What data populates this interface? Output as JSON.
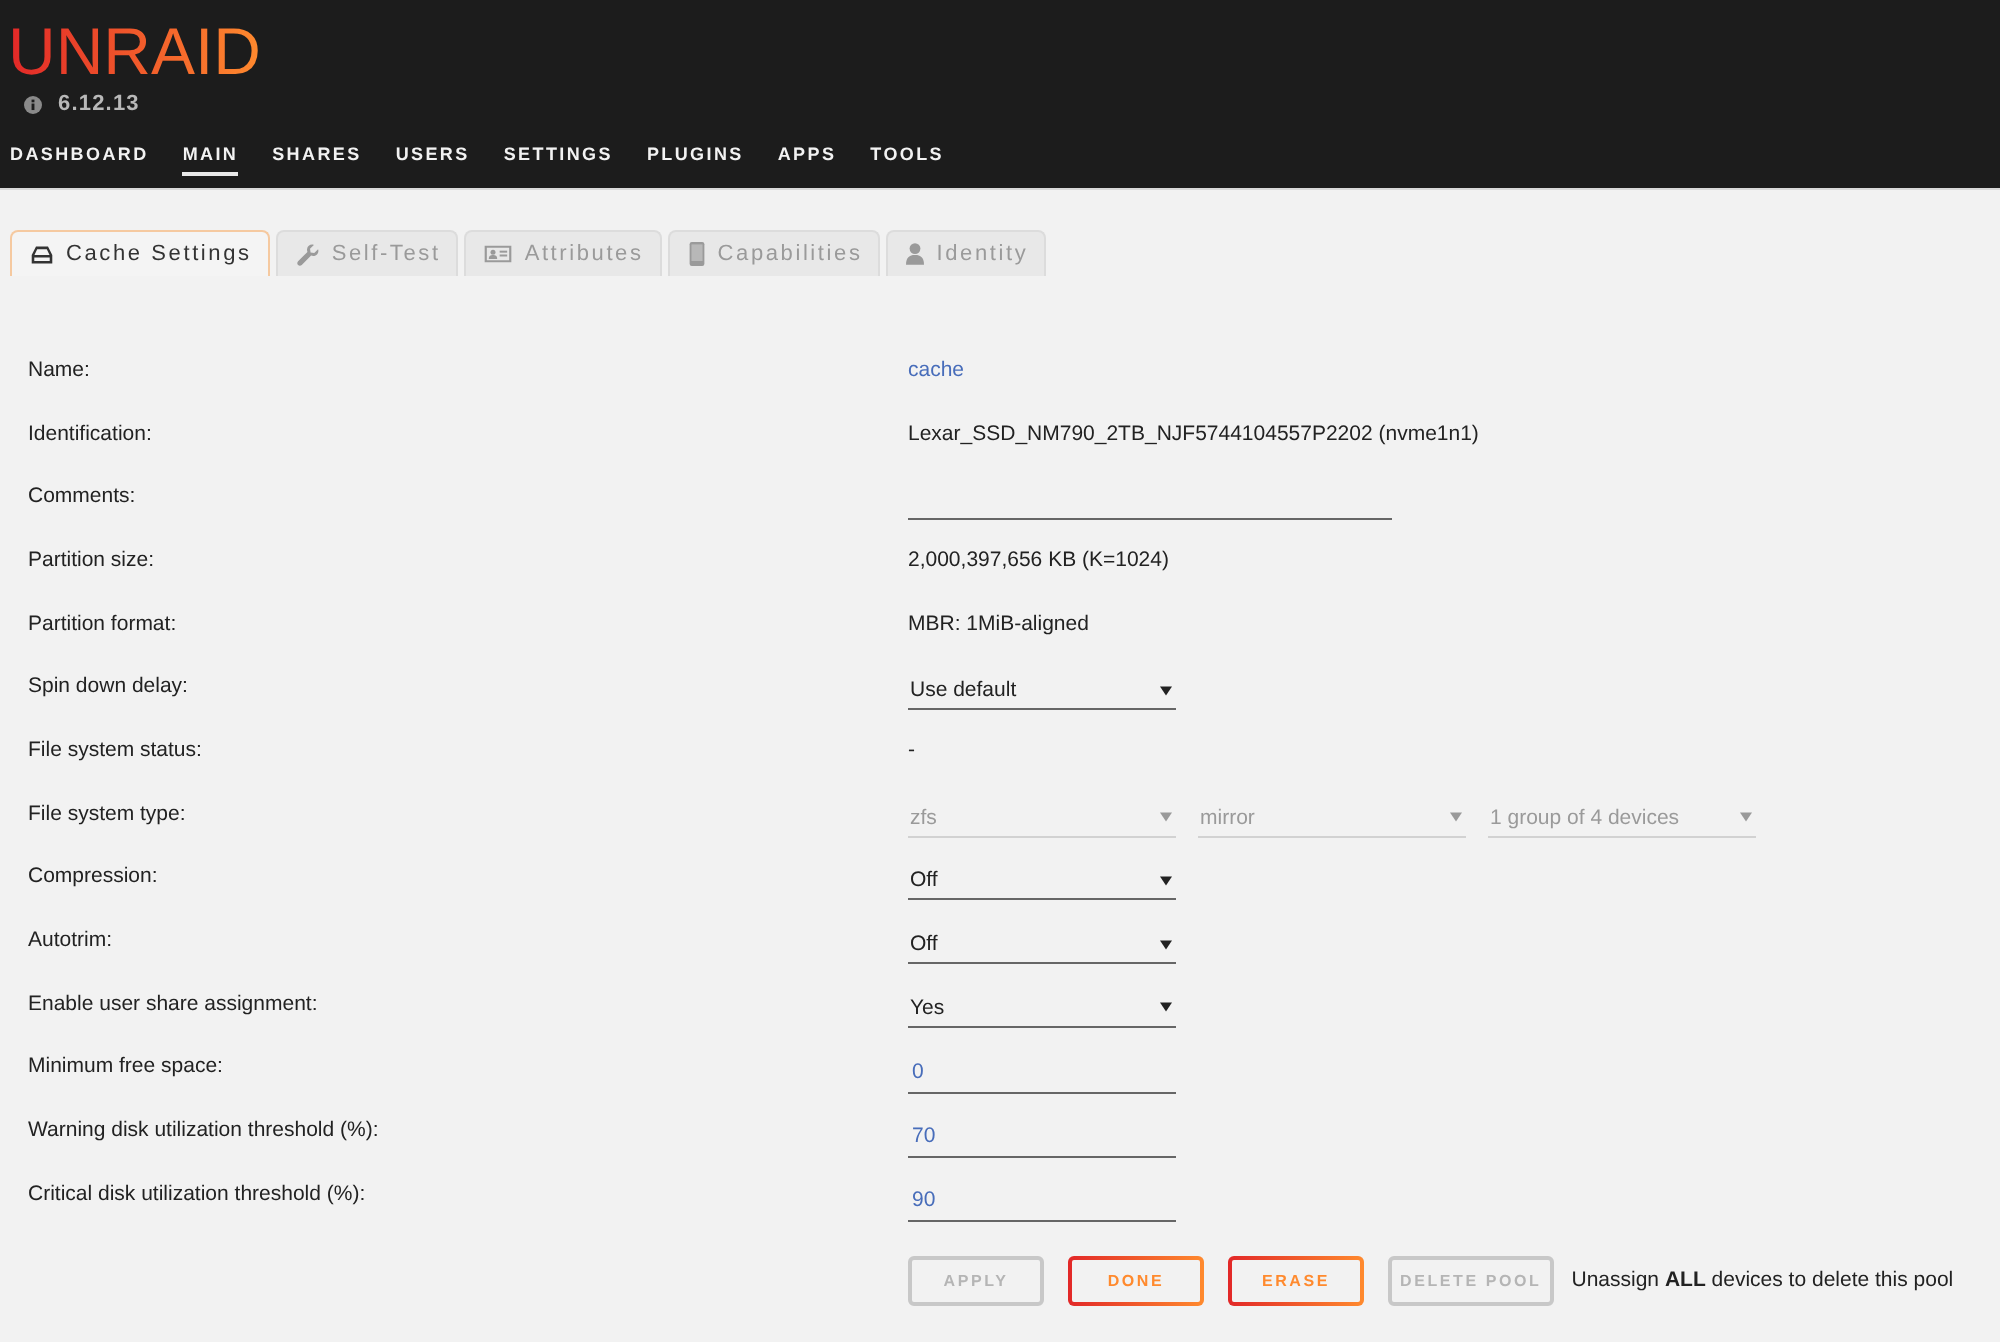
{
  "header": {
    "logo": "UNRAID",
    "version": "6.12.13"
  },
  "nav": [
    {
      "label": "DASHBOARD",
      "selected": false
    },
    {
      "label": "MAIN",
      "selected": true
    },
    {
      "label": "SHARES",
      "selected": false
    },
    {
      "label": "USERS",
      "selected": false
    },
    {
      "label": "SETTINGS",
      "selected": false
    },
    {
      "label": "PLUGINS",
      "selected": false
    },
    {
      "label": "APPS",
      "selected": false
    },
    {
      "label": "TOOLS",
      "selected": false
    }
  ],
  "tabs": [
    {
      "label": "Cache Settings",
      "selected": true
    },
    {
      "label": "Self-Test",
      "selected": false
    },
    {
      "label": "Attributes",
      "selected": false
    },
    {
      "label": "Capabilities",
      "selected": false
    },
    {
      "label": "Identity",
      "selected": false
    }
  ],
  "fields": [
    {
      "label": "Name:",
      "kind": "link",
      "value": "cache"
    },
    {
      "label": "Identification:",
      "kind": "text",
      "value": "Lexar_SSD_NM790_2TB_NJF5744104557P2202 (nvme1n1)"
    },
    {
      "label": "Comments:",
      "kind": "textbox"
    },
    {
      "label": "Partition size:",
      "kind": "text",
      "value": "2,000,397,656 KB (K=1024)"
    },
    {
      "label": "Partition format:",
      "kind": "text",
      "value": "MBR: 1MiB-aligned"
    },
    {
      "label": "Spin down delay:",
      "kind": "select",
      "selects": [
        {
          "value": "Use default",
          "disabled": false
        }
      ]
    },
    {
      "label": "File system status:",
      "kind": "text",
      "value": "-"
    },
    {
      "label": "File system type:",
      "kind": "select",
      "selects": [
        {
          "value": "zfs",
          "disabled": true
        },
        {
          "value": "mirror",
          "disabled": true
        },
        {
          "value": "1 group of 4 devices",
          "disabled": true
        }
      ]
    },
    {
      "label": "Compression:",
      "kind": "select",
      "selects": [
        {
          "value": "Off",
          "disabled": false
        }
      ]
    },
    {
      "label": "Autotrim:",
      "kind": "select",
      "selects": [
        {
          "value": "Off",
          "disabled": false
        }
      ]
    },
    {
      "label": "Enable user share assignment:",
      "kind": "select",
      "selects": [
        {
          "value": "Yes",
          "disabled": false
        }
      ]
    },
    {
      "label": "Minimum free space:",
      "kind": "number",
      "value": "0"
    },
    {
      "label": "Warning disk utilization threshold (%):",
      "kind": "number",
      "value": "70"
    },
    {
      "label": "Critical disk utilization threshold (%):",
      "kind": "number",
      "value": "90"
    }
  ],
  "buttons": [
    {
      "label": "APPLY",
      "disabled": true
    },
    {
      "label": "DONE",
      "disabled": false
    },
    {
      "label": "ERASE",
      "disabled": false
    },
    {
      "label": "DELETE POOL",
      "disabled": true
    }
  ],
  "note": "Unassign **ALL** devices to delete this pool"
}
